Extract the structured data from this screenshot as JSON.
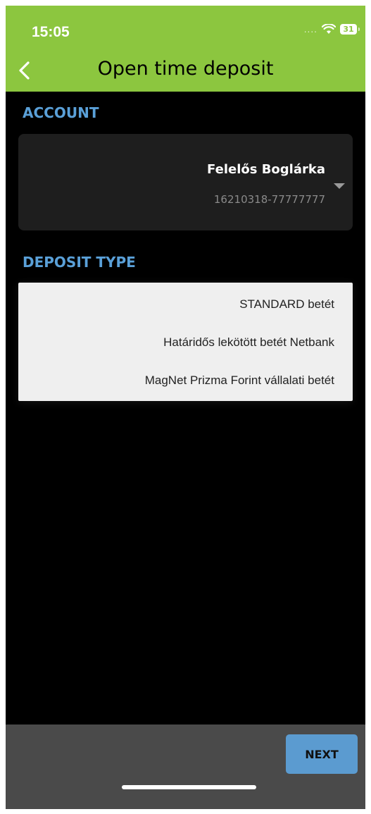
{
  "status_bar": {
    "time": "15:05",
    "signal": "....",
    "battery": "31"
  },
  "header": {
    "title": "Open time deposit",
    "back_icon": "chevron-left-icon",
    "color": "#8cc63f"
  },
  "account_section": {
    "label": "ACCOUNT",
    "account_name": "Felelős Boglárka",
    "account_number": "16210318-77777777",
    "dropdown_icon": "caret-down-icon"
  },
  "deposit_section": {
    "label": "DEPOSIT TYPE",
    "options": [
      "STANDARD betét",
      "Határidős lekötött betét Netbank",
      "MagNet Prizma Forint vállalati betét"
    ]
  },
  "footer": {
    "next_label": "NEXT",
    "accent": "#5b9bd0"
  }
}
